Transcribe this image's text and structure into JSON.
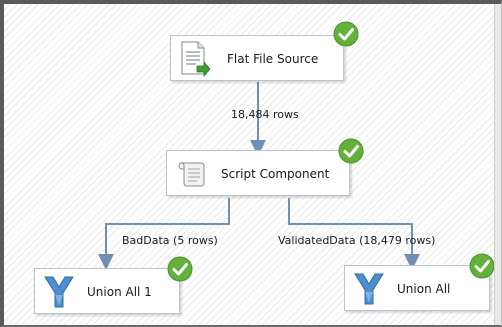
{
  "components": {
    "flat_file_source": {
      "label": "Flat File Source",
      "icon": "flat-file-source-icon",
      "status": "success-check-icon"
    },
    "script_component": {
      "label": "Script Component",
      "icon": "script-component-icon",
      "status": "success-check-icon"
    },
    "union_all_1": {
      "label": "Union All 1",
      "icon": "union-all-icon",
      "status": "success-check-icon"
    },
    "union_all": {
      "label": "Union All",
      "icon": "union-all-icon",
      "status": "success-check-icon"
    }
  },
  "paths": {
    "source_to_script": {
      "label": "18,484 rows"
    },
    "bad_data": {
      "label": "BadData (5 rows)"
    },
    "validated_data": {
      "label": "ValidatedData (18,479 rows)"
    }
  },
  "colors": {
    "connector": "#6f8fb4",
    "success": "#63b13b",
    "component_border": "#b7c3d1"
  }
}
